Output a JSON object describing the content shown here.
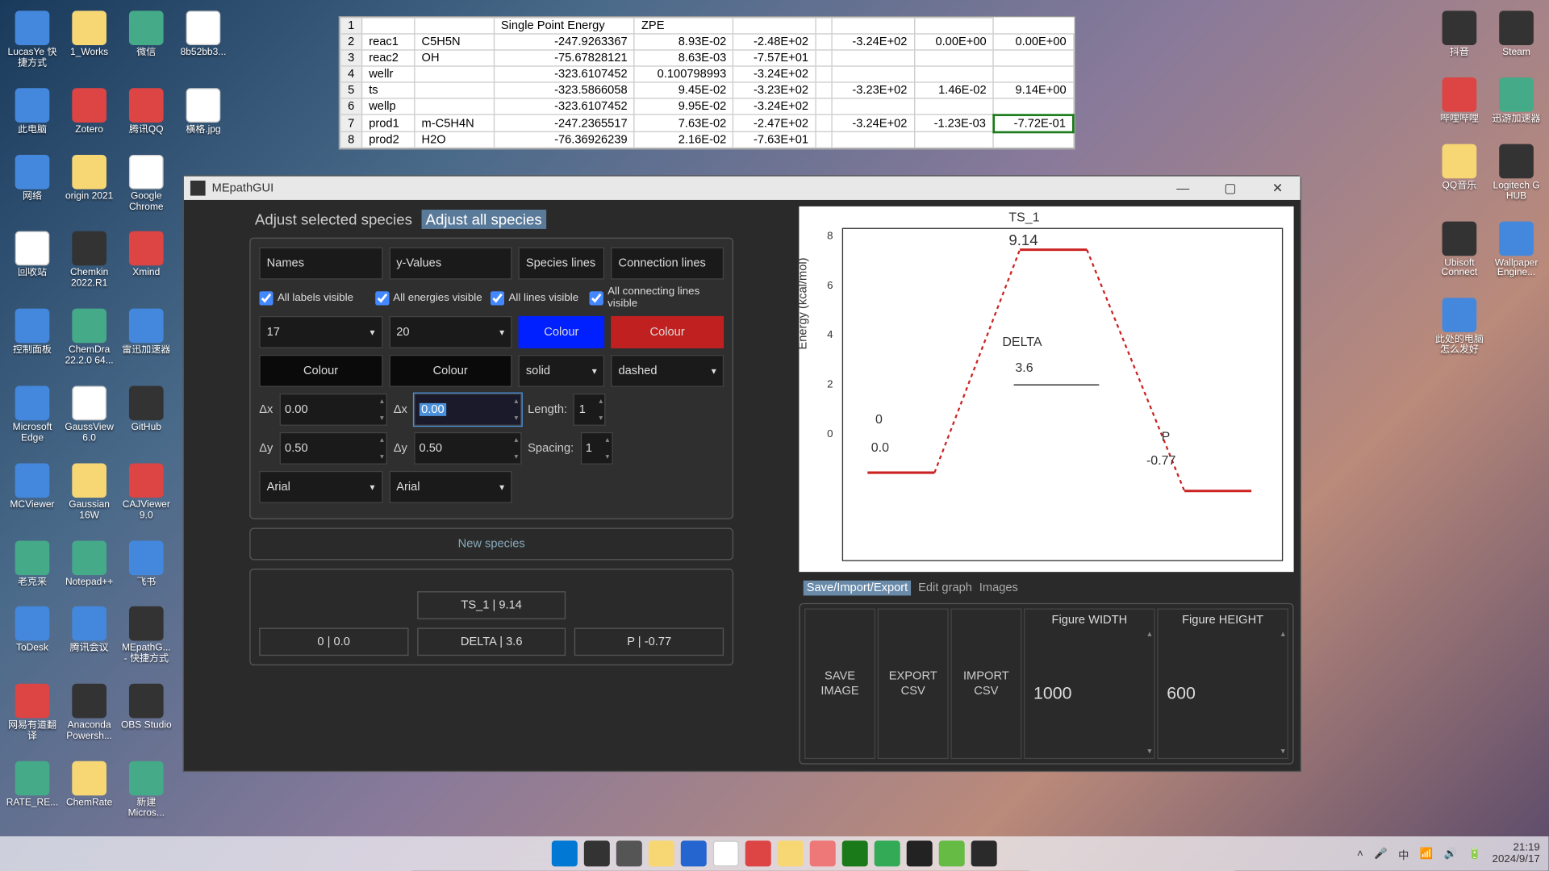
{
  "desktop_left": [
    {
      "label": "LucasYe 快捷方式",
      "cls": "blue"
    },
    {
      "label": "1_Works",
      "cls": "folder"
    },
    {
      "label": "微信",
      "cls": "green"
    },
    {
      "label": "8b52bb3...",
      "cls": "white"
    },
    {
      "label": "此电脑",
      "cls": "blue"
    },
    {
      "label": "Zotero",
      "cls": "red"
    },
    {
      "label": "腾讯QQ",
      "cls": "red"
    },
    {
      "label": "横格.jpg",
      "cls": "white"
    },
    {
      "label": "网络",
      "cls": "blue"
    },
    {
      "label": "origin 2021",
      "cls": "folder"
    },
    {
      "label": "Google Chrome",
      "cls": "white"
    },
    {
      "label": "",
      "cls": ""
    },
    {
      "label": "回收站",
      "cls": "white"
    },
    {
      "label": "Chemkin 2022.R1",
      "cls": "dark"
    },
    {
      "label": "Xmind",
      "cls": "red"
    },
    {
      "label": "",
      "cls": ""
    },
    {
      "label": "控制面板",
      "cls": "blue"
    },
    {
      "label": "ChemDra 22.2.0 64...",
      "cls": "green"
    },
    {
      "label": "雷迅加速器",
      "cls": "blue"
    },
    {
      "label": "",
      "cls": ""
    },
    {
      "label": "Microsoft Edge",
      "cls": "blue"
    },
    {
      "label": "GaussView 6.0",
      "cls": "white"
    },
    {
      "label": "GitHub",
      "cls": "dark"
    },
    {
      "label": "",
      "cls": ""
    },
    {
      "label": "MCViewer",
      "cls": "blue"
    },
    {
      "label": "Gaussian 16W",
      "cls": "folder"
    },
    {
      "label": "CAJViewer 9.0",
      "cls": "red"
    },
    {
      "label": "",
      "cls": ""
    },
    {
      "label": "老克来",
      "cls": "green"
    },
    {
      "label": "Notepad++",
      "cls": "green"
    },
    {
      "label": "飞书",
      "cls": "blue"
    },
    {
      "label": "",
      "cls": ""
    },
    {
      "label": "ToDesk",
      "cls": "blue"
    },
    {
      "label": "腾讯会议",
      "cls": "blue"
    },
    {
      "label": "MEpathG... - 快捷方式",
      "cls": "dark"
    },
    {
      "label": "",
      "cls": ""
    },
    {
      "label": "网易有道翻译",
      "cls": "red"
    },
    {
      "label": "Anaconda Powersh...",
      "cls": "dark"
    },
    {
      "label": "OBS Studio",
      "cls": "dark"
    },
    {
      "label": "",
      "cls": ""
    },
    {
      "label": "RATE_RE...",
      "cls": "green"
    },
    {
      "label": "ChemRate",
      "cls": "folder"
    },
    {
      "label": "新建 Micros...",
      "cls": "green"
    },
    {
      "label": "",
      "cls": ""
    }
  ],
  "desktop_right": [
    {
      "label": "抖音",
      "cls": "dark"
    },
    {
      "label": "Steam",
      "cls": "dark"
    },
    {
      "label": "哔哩哔哩",
      "cls": "red"
    },
    {
      "label": "迅游加速器",
      "cls": "green"
    },
    {
      "label": "QQ音乐",
      "cls": "folder"
    },
    {
      "label": "Logitech G HUB",
      "cls": "dark"
    },
    {
      "label": "Ubisoft Connect",
      "cls": "dark"
    },
    {
      "label": "Wallpaper Engine...",
      "cls": "blue"
    },
    {
      "label": "此处的电脑 怎么发好",
      "cls": "blue"
    },
    {
      "label": "",
      "cls": ""
    }
  ],
  "spreadsheet": {
    "headers": [
      "",
      "",
      "Single Point Energy",
      "ZPE",
      "",
      "",
      "",
      "",
      ""
    ],
    "rows": [
      [
        "1",
        "",
        "",
        "",
        "",
        "",
        "",
        "",
        ""
      ],
      [
        "2",
        "reac1",
        "C5H5N",
        "-247.9263367",
        "8.93E-02",
        "-2.48E+02",
        "",
        "-3.24E+02",
        "0.00E+00",
        "0.00E+00"
      ],
      [
        "3",
        "reac2",
        "OH",
        "-75.67828121",
        "8.63E-03",
        "-7.57E+01",
        "",
        "",
        "",
        ""
      ],
      [
        "4",
        "wellr",
        "",
        "-323.6107452",
        "0.100798993",
        "-3.24E+02",
        "",
        "",
        "",
        ""
      ],
      [
        "5",
        "ts",
        "",
        "-323.5866058",
        "9.45E-02",
        "-3.23E+02",
        "",
        "-3.23E+02",
        "1.46E-02",
        "9.14E+00"
      ],
      [
        "6",
        "wellp",
        "",
        "-323.6107452",
        "9.95E-02",
        "-3.24E+02",
        "",
        "",
        "",
        ""
      ],
      [
        "7",
        "prod1",
        "m-C5H4N",
        "-247.2365517",
        "7.63E-02",
        "-2.47E+02",
        "",
        "-3.24E+02",
        "-1.23E-03",
        "-7.72E-01"
      ],
      [
        "8",
        "prod2",
        "H2O",
        "-76.36926239",
        "2.16E-02",
        "-7.63E+01",
        "",
        "",
        "",
        ""
      ]
    ]
  },
  "app": {
    "title": "MEpathGUI",
    "tabs_top": {
      "inactive": "Adjust selected species",
      "active": "Adjust all species"
    },
    "headers": [
      "Names",
      "y-Values",
      "Species lines",
      "Connection lines"
    ],
    "checks": [
      "All labels visible",
      "All energies visible",
      "All lines visible",
      "All connecting lines visible"
    ],
    "sel17": "17",
    "sel20": "20",
    "colour": "Colour",
    "solid": "solid",
    "dashed": "dashed",
    "dx": "Δx",
    "dy": "Δy",
    "v000": "0.00",
    "v000b": "0.00",
    "v050": "0.50",
    "length": "Length:",
    "spacing": "Spacing:",
    "one": "1",
    "arial": "Arial",
    "newspecies": "New species",
    "species": [
      "",
      "TS_1 | 9.14",
      "",
      "0 | 0.0",
      "DELTA | 3.6",
      "P | -0.77"
    ],
    "bt_tabs": {
      "active": "Save/Import/Export",
      "others": [
        "Edit graph",
        "Images"
      ]
    },
    "export_btns": [
      "SAVE IMAGE",
      "EXPORT CSV",
      "IMPORT CSV"
    ],
    "fig_w_lbl": "Figure WIDTH",
    "fig_h_lbl": "Figure HEIGHT",
    "fig_w": "1000",
    "fig_h": "600",
    "win_min": "—",
    "win_max": "▢",
    "win_close": "✕"
  },
  "chart_data": {
    "type": "line",
    "ylabel": "Energy (kcal/mol)",
    "ylim": [
      -1,
      10
    ],
    "yticks": [
      0,
      2,
      4,
      6,
      8
    ],
    "points": [
      {
        "name": "0",
        "value": 0.0,
        "x": 0
      },
      {
        "name": "TS_1",
        "value": 9.14,
        "x": 1
      },
      {
        "name": "DELTA",
        "value": 3.6,
        "x": 1,
        "note": "annotation"
      },
      {
        "name": "P",
        "value": -0.77,
        "x": 2
      }
    ]
  },
  "taskbar": {
    "time": "21:19",
    "date": "2024/9/17"
  }
}
